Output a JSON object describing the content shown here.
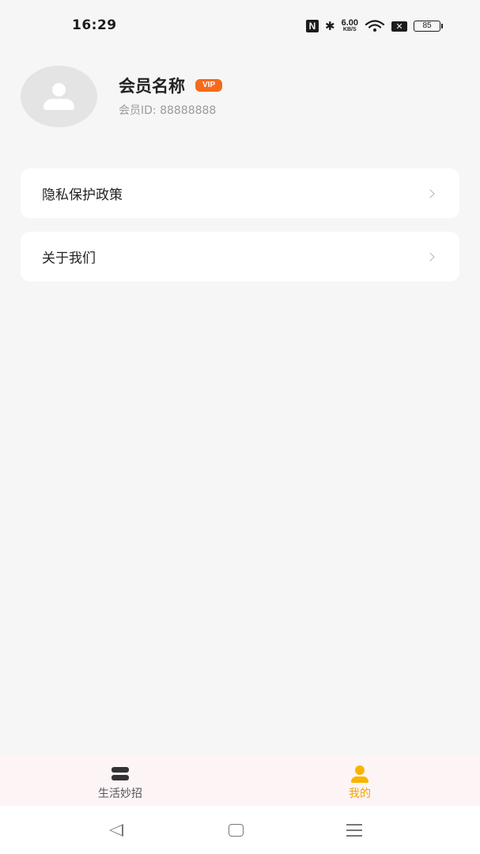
{
  "status_bar": {
    "time": "16:29",
    "nfc": "N",
    "net_speed_value": "6.00",
    "net_speed_unit": "KB/S",
    "battery": "85"
  },
  "profile": {
    "name": "会员名称",
    "vip": "VIP",
    "member_id": "会员ID: 88888888"
  },
  "menu": {
    "items": [
      {
        "label": "隐私保护政策"
      },
      {
        "label": "关于我们"
      }
    ]
  },
  "tabbar": {
    "items": [
      {
        "label": "生活妙招",
        "icon": "life-tips-icon",
        "active": false
      },
      {
        "label": "我的",
        "icon": "profile-icon",
        "active": true
      }
    ],
    "active_color": "#f2a500",
    "background": "#fdf4f6"
  },
  "colors": {
    "vip_badge": "#f66a1a",
    "page_background": "#f6f6f6"
  }
}
